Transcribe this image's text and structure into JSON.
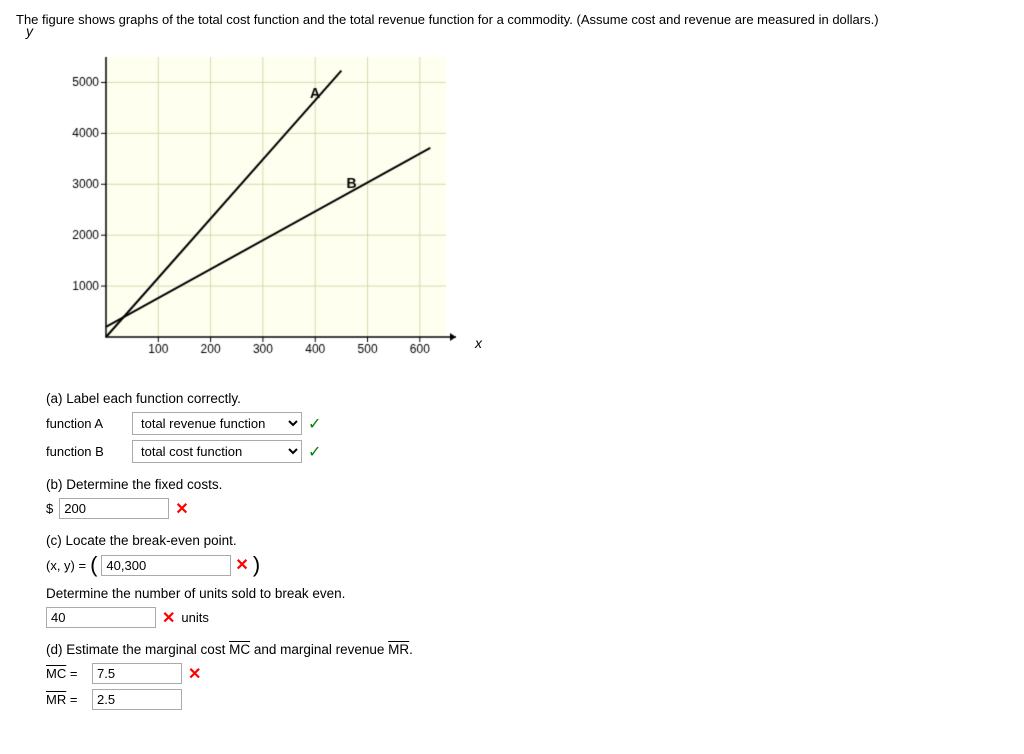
{
  "intro": "The figure shows graphs of the total cost function and the total revenue function for a commodity. (Assume cost and revenue are measured in dollars.)",
  "chart": {
    "yLabel": "y",
    "xLabel": "x",
    "xTicks": [
      "100",
      "200",
      "300",
      "400",
      "500",
      "600"
    ],
    "yTicks": [
      "1000",
      "2000",
      "3000",
      "4000",
      "5000"
    ],
    "labelA": "A",
    "labelB": "B"
  },
  "partA": {
    "title": "(a) Label each function correctly.",
    "functionALabel": "function A",
    "functionAValue": "total revenue function",
    "functionBLabel": "function B",
    "functionBValue": "total cost function",
    "options": [
      "total revenue function",
      "total cost function"
    ]
  },
  "partB": {
    "title": "(b) Determine the fixed costs.",
    "dollar": "$",
    "inputValue": "200"
  },
  "partC": {
    "title": "(c) Locate the break-even point.",
    "label": "(x, y) =",
    "inputValue": "40,300",
    "unitsTitle": "Determine the number of units sold to break even.",
    "unitsValue": "40",
    "unitsLabel": "units"
  },
  "partD": {
    "title": "(d) Estimate the marginal cost MC and marginal revenue MR.",
    "mcLabel": "MC =",
    "mcValue": "7.5",
    "mrLabel": "MR =",
    "mrValue": "2.5"
  },
  "icons": {
    "check": "✓",
    "cross": "✕"
  }
}
